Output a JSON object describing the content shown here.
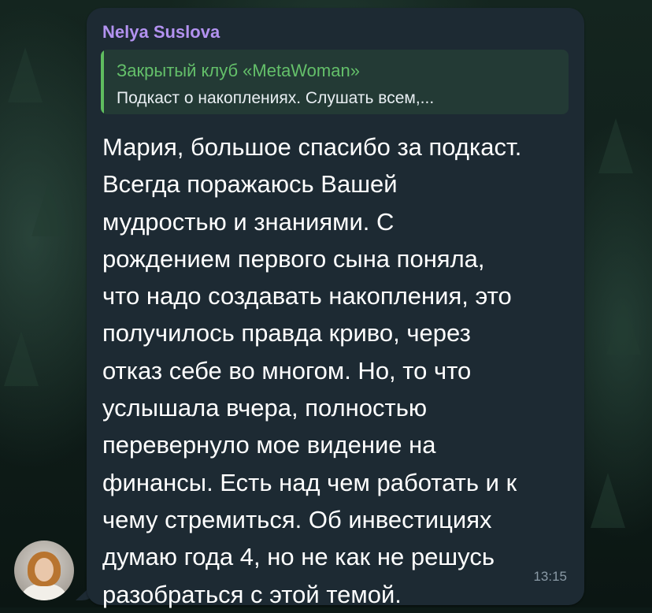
{
  "message": {
    "sender_name": "Nelya Suslova",
    "reply": {
      "title": "Закрытый клуб «MetaWoman»",
      "preview": "Подкаст о накоплениях. Слушать всем,..."
    },
    "text_lines": [
      "Мария, большое спасибо за подкаст.",
      "Всегда поражаюсь Вашей",
      "мудростью и знаниями. С",
      "рождением первого сына поняла,",
      "что надо создавать накопления, это",
      "получилось правда криво, через",
      "отказ себе во многом. Но, то что",
      "услышала вчера, полностью",
      "перевернуло мое видение на",
      "финансы. Есть над чем работать и к",
      "чему стремиться. Об инвестициях",
      "думаю года 4, но не как не решусь",
      "разобраться с этой темой."
    ],
    "time": "13:15"
  },
  "colors": {
    "bubble": "#1d2a33",
    "sender": "#b392f0",
    "reply_accent": "#5fbd5f",
    "text": "#ffffff",
    "time": "#8a9aa6"
  },
  "icons": {
    "avatar": "user-avatar-photo"
  }
}
